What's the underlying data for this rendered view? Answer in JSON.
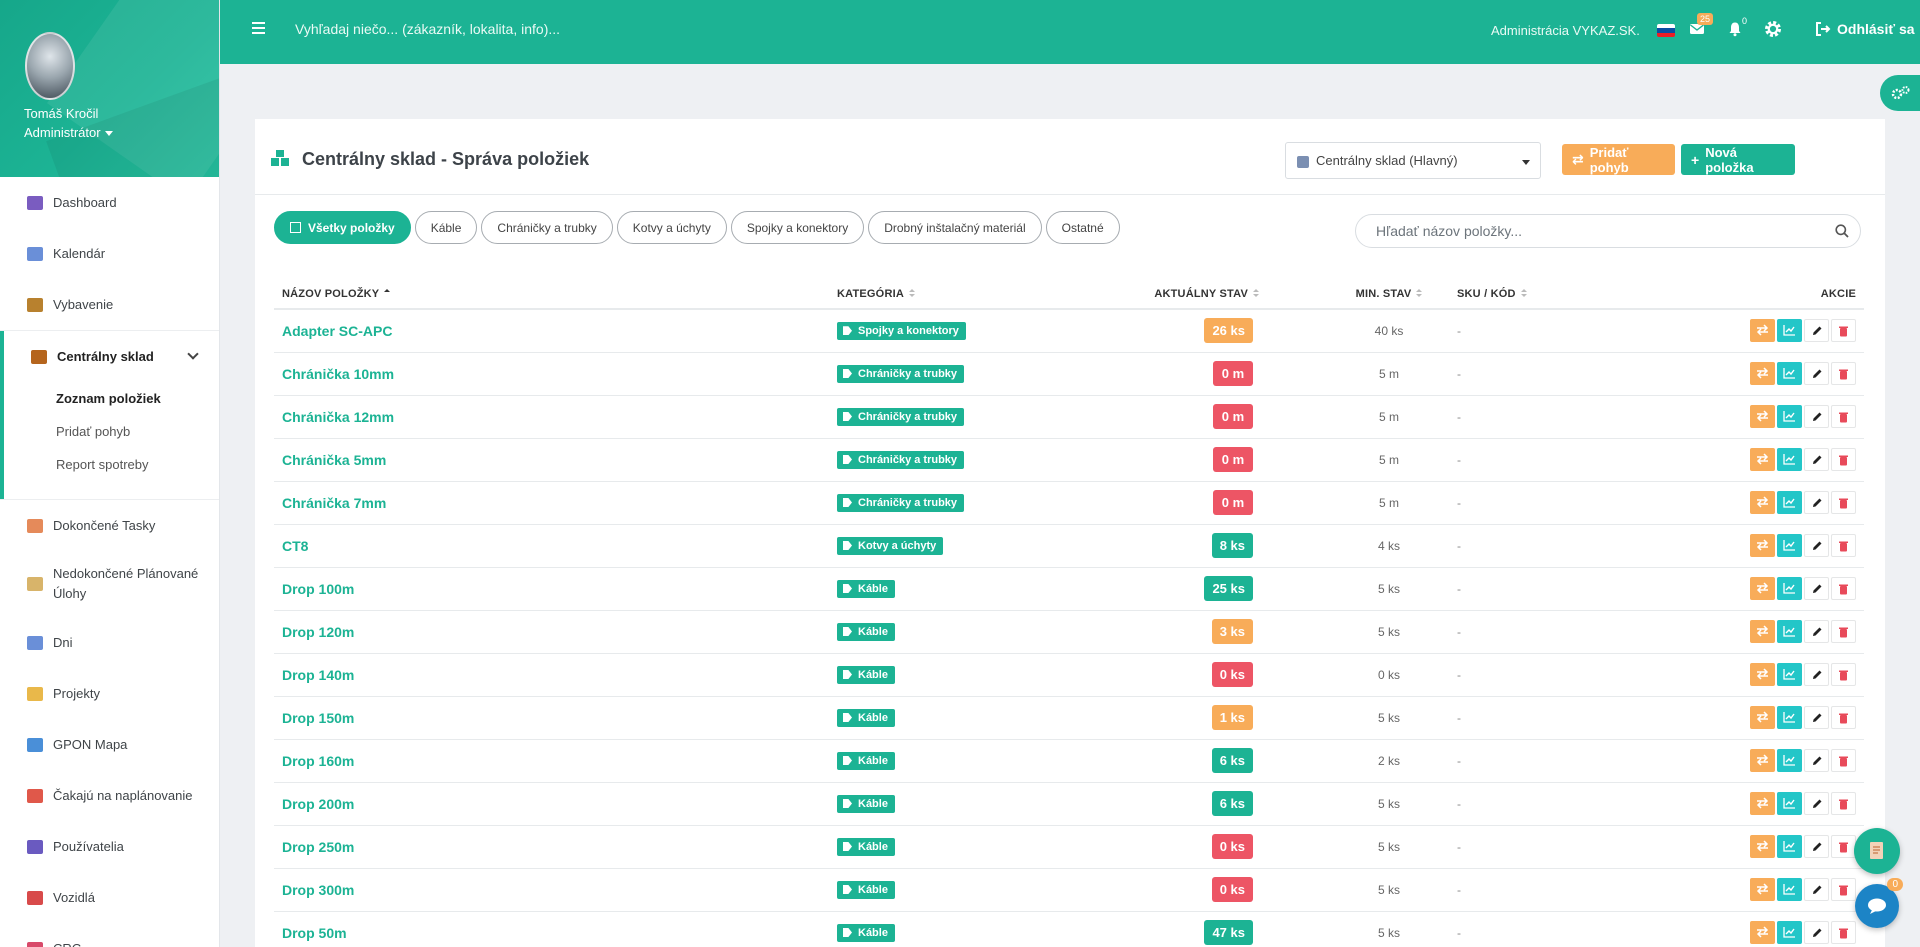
{
  "app": {
    "search_placeholder": "Vyhľadaj niečo... (zákazník, lokalita, info)...",
    "admin_label": "Administrácia VYKAZ.SK.",
    "mail_count": "25",
    "notif_count": "0",
    "logout_label": "Odhlásiť sa",
    "accent_color": "#1cb394"
  },
  "profile": {
    "name": "Tomáš Kročil",
    "role": "Administrátor"
  },
  "sidebar": {
    "items_top": [
      {
        "label": "Dashboard",
        "icon": "chart-icon",
        "color": "#7a5cc0"
      },
      {
        "label": "Kalendár",
        "icon": "calendar-icon",
        "color": "#6a8fd8"
      },
      {
        "label": "Vybavenie",
        "icon": "tools-icon",
        "color": "#b8812e"
      }
    ],
    "section": {
      "label": "Centrálny sklad",
      "icon": "box-icon",
      "color": "#b5651d",
      "sub_items": [
        "Zoznam položiek",
        "Pridať pohyb",
        "Report spotreby"
      ]
    },
    "items_bottom": [
      {
        "label": "Dokončené Tasky",
        "icon": "memo-icon",
        "color": "#e58a5a"
      },
      {
        "label": "Nedokončené Plánované Úlohy",
        "icon": "hourglass-icon",
        "color": "#d8b46a"
      },
      {
        "label": "Dni",
        "icon": "calendar-days-icon",
        "color": "#6a8fd8"
      },
      {
        "label": "Projekty",
        "icon": "folder-icon",
        "color": "#e9b84a"
      },
      {
        "label": "GPON Mapa",
        "icon": "map-icon",
        "color": "#4a8fd8"
      },
      {
        "label": "Čakajú na naplánovanie",
        "icon": "alarm-clock-icon",
        "color": "#e0584a"
      },
      {
        "label": "Používatelia",
        "icon": "users-icon",
        "color": "#6a5ac0"
      },
      {
        "label": "Vozidlá",
        "icon": "car-icon",
        "color": "#d84a4a"
      },
      {
        "label": "CRC",
        "icon": "pin-icon",
        "color": "#d84a6a"
      }
    ]
  },
  "page": {
    "title": "Centrálny sklad - Správa položiek",
    "warehouse_select": "Centrálny sklad (Hlavný)",
    "btn_add_movement": "Pridať pohyb",
    "btn_new_item": "Nová položka",
    "search_placeholder": "Hľadať názov položky..."
  },
  "filters": [
    "Všetky položky",
    "Káble",
    "Chráničky a trubky",
    "Kotvy a úchyty",
    "Spojky a konektory",
    "Drobný inštalačný materiál",
    "Ostatné"
  ],
  "table": {
    "headers": {
      "name": "NÁZOV POLOŽKY",
      "category": "KATEGÓRIA",
      "stock": "AKTUÁLNY STAV",
      "min": "MIN. STAV",
      "sku": "SKU / KÓD",
      "actions": "AKCIE"
    },
    "rows": [
      {
        "name": "Adapter SC-APC",
        "category": "Spojky a konektory",
        "stock": "26 ks",
        "status": "orange",
        "min": "40 ks",
        "sku": "-"
      },
      {
        "name": "Chránička 10mm",
        "category": "Chráničky a trubky",
        "stock": "0 m",
        "status": "red",
        "min": "5 m",
        "sku": "-"
      },
      {
        "name": "Chránička 12mm",
        "category": "Chráničky a trubky",
        "stock": "0 m",
        "status": "red",
        "min": "5 m",
        "sku": "-"
      },
      {
        "name": "Chránička 5mm",
        "category": "Chráničky a trubky",
        "stock": "0 m",
        "status": "red",
        "min": "5 m",
        "sku": "-"
      },
      {
        "name": "Chránička 7mm",
        "category": "Chráničky a trubky",
        "stock": "0 m",
        "status": "red",
        "min": "5 m",
        "sku": "-"
      },
      {
        "name": "CT8",
        "category": "Kotvy a úchyty",
        "stock": "8 ks",
        "status": "green",
        "min": "4 ks",
        "sku": "-"
      },
      {
        "name": "Drop 100m",
        "category": "Káble",
        "stock": "25 ks",
        "status": "green",
        "min": "5 ks",
        "sku": "-"
      },
      {
        "name": "Drop 120m",
        "category": "Káble",
        "stock": "3 ks",
        "status": "orange",
        "min": "5 ks",
        "sku": "-"
      },
      {
        "name": "Drop 140m",
        "category": "Káble",
        "stock": "0 ks",
        "status": "red",
        "min": "0 ks",
        "sku": "-"
      },
      {
        "name": "Drop 150m",
        "category": "Káble",
        "stock": "1 ks",
        "status": "orange",
        "min": "5 ks",
        "sku": "-"
      },
      {
        "name": "Drop 160m",
        "category": "Káble",
        "stock": "6 ks",
        "status": "green",
        "min": "2 ks",
        "sku": "-"
      },
      {
        "name": "Drop 200m",
        "category": "Káble",
        "stock": "6 ks",
        "status": "green",
        "min": "5 ks",
        "sku": "-"
      },
      {
        "name": "Drop 250m",
        "category": "Káble",
        "stock": "0 ks",
        "status": "red",
        "min": "5 ks",
        "sku": "-"
      },
      {
        "name": "Drop 300m",
        "category": "Káble",
        "stock": "0 ks",
        "status": "red",
        "min": "5 ks",
        "sku": "-"
      },
      {
        "name": "Drop 50m",
        "category": "Káble",
        "stock": "47 ks",
        "status": "green",
        "min": "5 ks",
        "sku": "-"
      }
    ]
  },
  "chat": {
    "unread": "0"
  }
}
